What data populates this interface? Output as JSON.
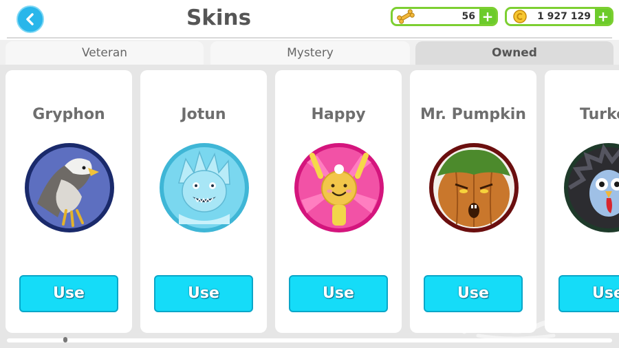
{
  "header": {
    "title": "Skins"
  },
  "currencies": [
    {
      "icon": "bone-icon",
      "value": "56"
    },
    {
      "icon": "coin-icon",
      "value": "1 927 129"
    }
  ],
  "tabs": [
    {
      "label": "Veteran",
      "active": false
    },
    {
      "label": "Mystery",
      "active": false
    },
    {
      "label": "Owned",
      "active": true
    }
  ],
  "skins": [
    {
      "name": "Gryphon",
      "button": "Use",
      "icon": "gryphon-skin-icon",
      "ring_color": "#1a2a6b"
    },
    {
      "name": "Jotun",
      "button": "Use",
      "icon": "jotun-skin-icon",
      "ring_color": "#3fb6d6"
    },
    {
      "name": "Happy",
      "button": "Use",
      "icon": "happy-skin-icon",
      "ring_color": "#d4157d"
    },
    {
      "name": "Mr. Pumpkin",
      "button": "Use",
      "icon": "mr-pumpkin-skin-icon",
      "ring_color": "#6b0f0f"
    },
    {
      "name": "Turke",
      "button": "Use",
      "icon": "turkey-skin-icon",
      "ring_color": "#1e3a2a"
    }
  ],
  "colors": {
    "accent": "#15dcf8",
    "currency_border": "#7ccf31",
    "back_button": "#29b6ea"
  }
}
